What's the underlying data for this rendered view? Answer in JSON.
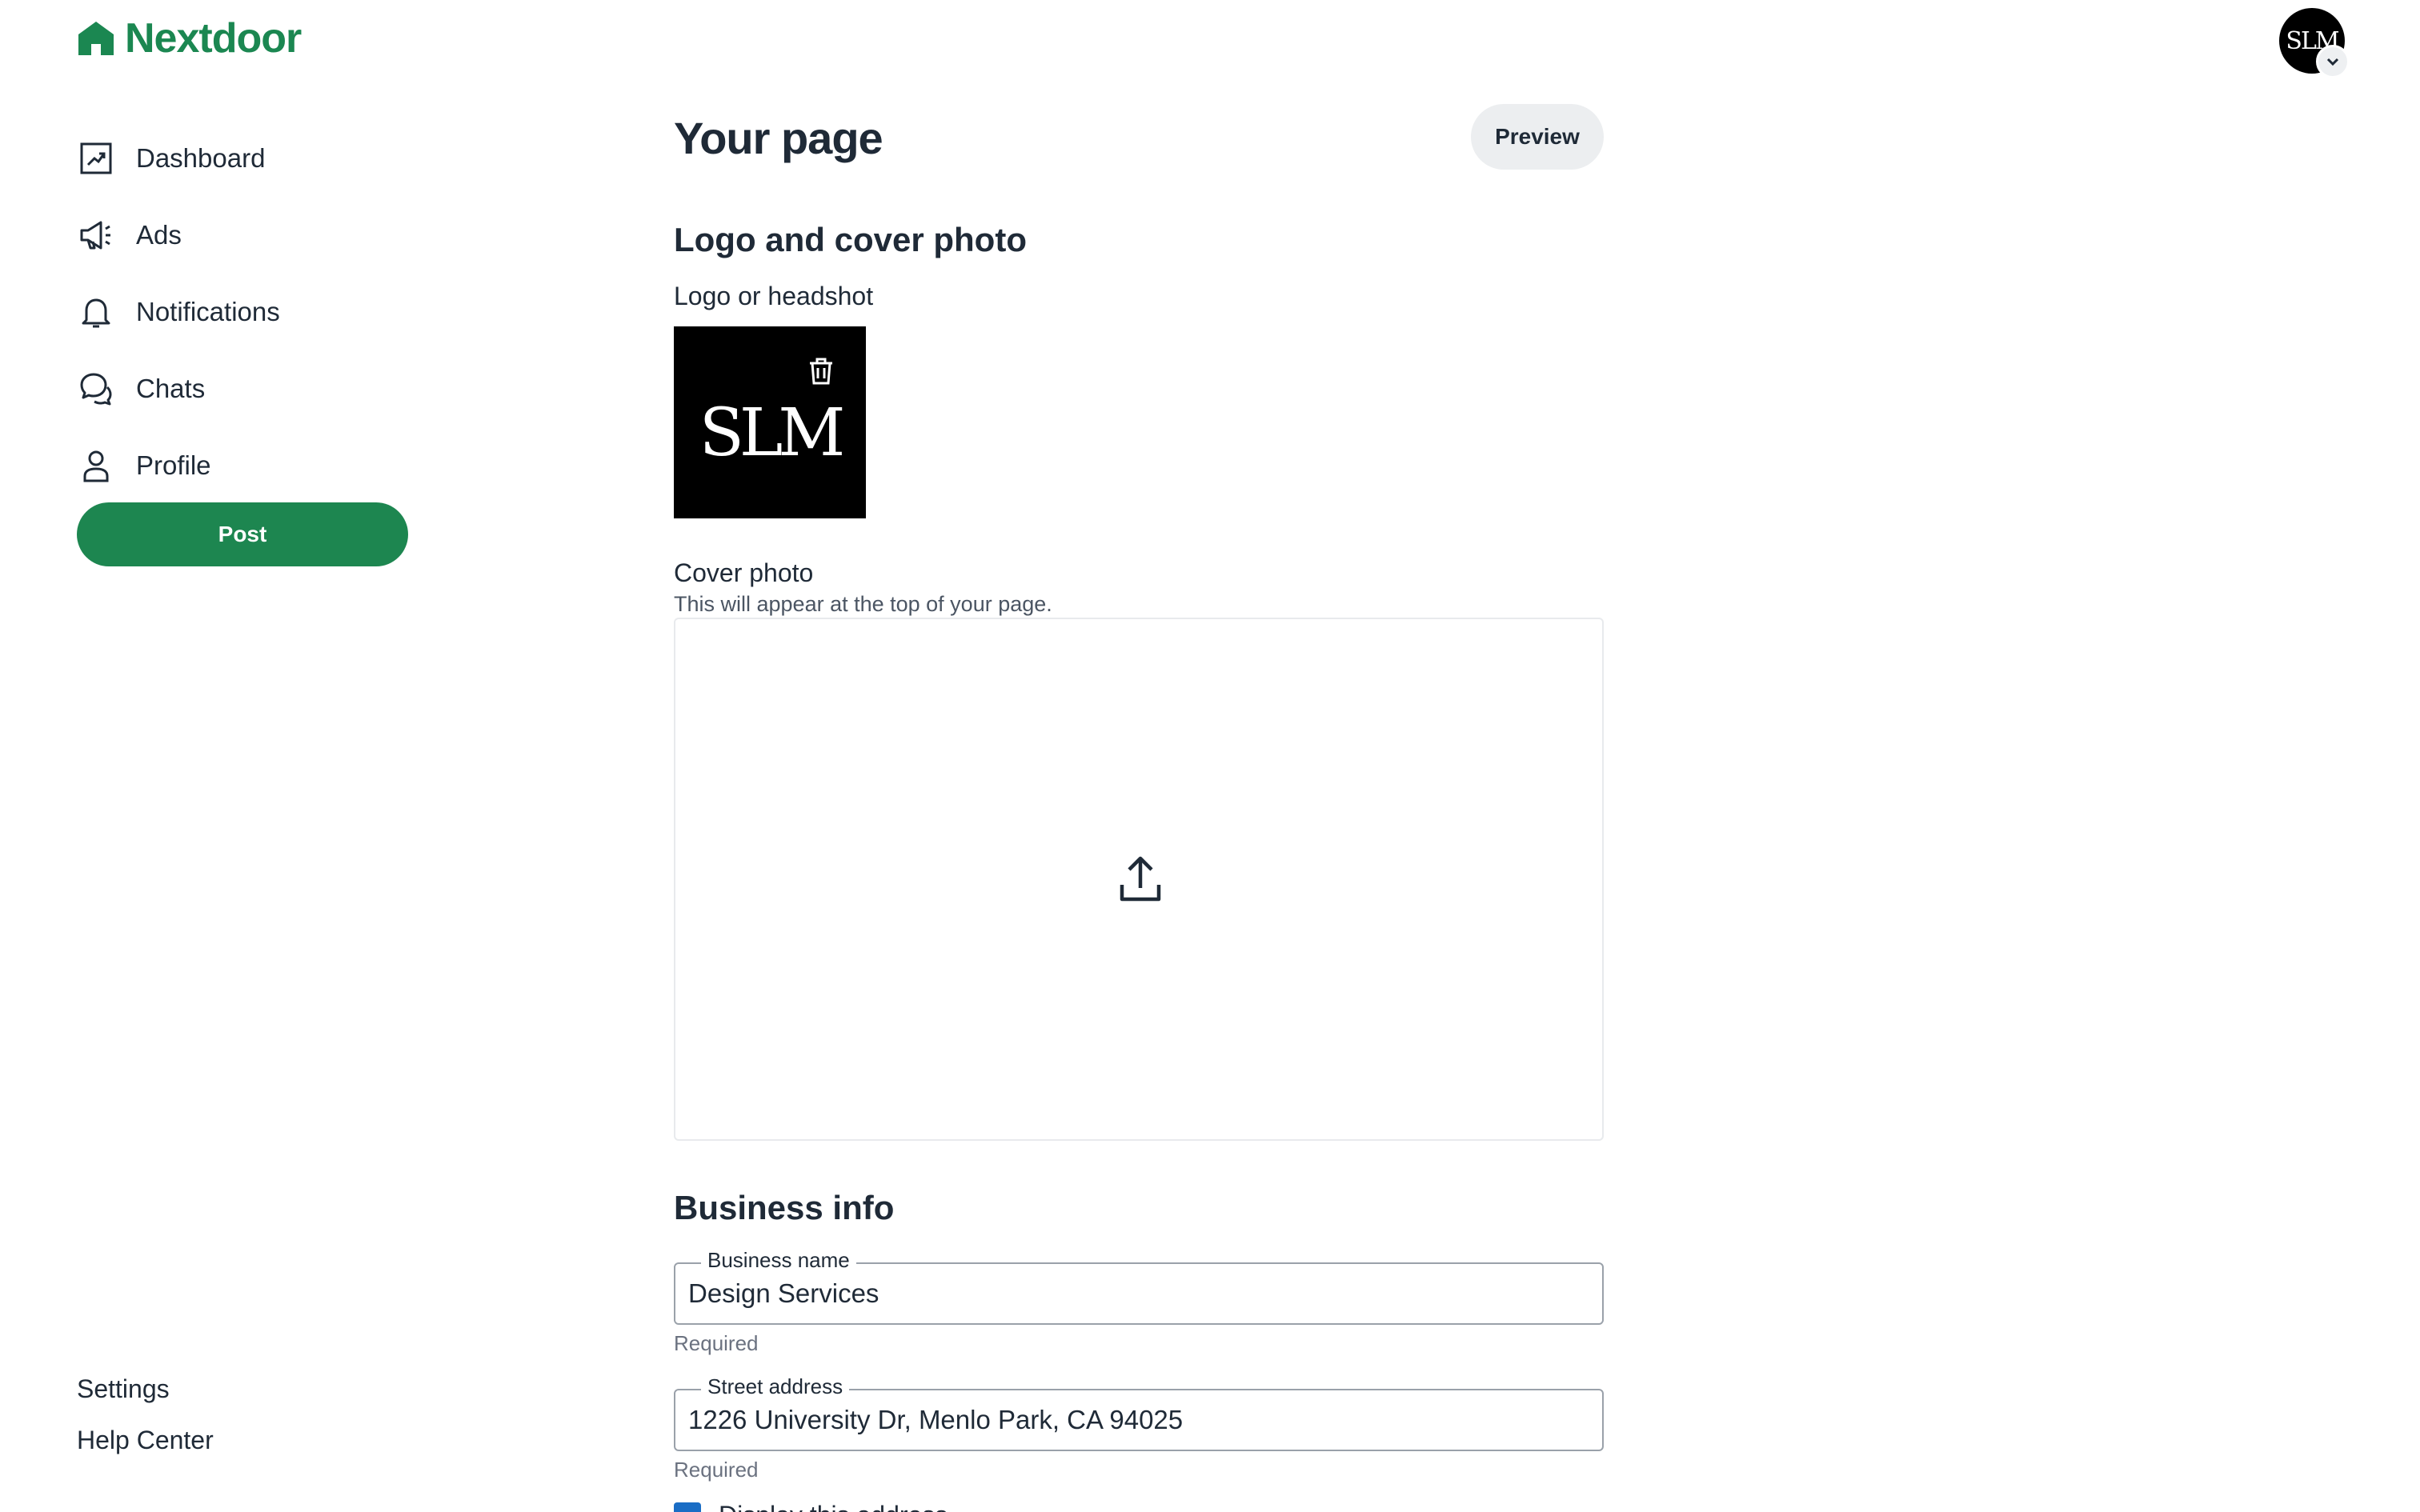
{
  "brand": {
    "name": "Nextdoor",
    "icon": "house-icon",
    "color": "#1b8751"
  },
  "nav": {
    "items": [
      {
        "label": "Dashboard",
        "icon": "dashboard-chart-icon"
      },
      {
        "label": "Ads",
        "icon": "megaphone-icon"
      },
      {
        "label": "Notifications",
        "icon": "bell-icon"
      },
      {
        "label": "Chats",
        "icon": "chat-bubbles-icon"
      },
      {
        "label": "Profile",
        "icon": "person-icon"
      }
    ],
    "post_label": "Post"
  },
  "footer": {
    "settings_label": "Settings",
    "help_label": "Help Center"
  },
  "account": {
    "avatar_text": "SLM",
    "menu_icon": "chevron-down-icon"
  },
  "page": {
    "title": "Your page",
    "preview_label": "Preview"
  },
  "logo_section": {
    "title": "Logo and cover photo",
    "logo_label": "Logo or headshot",
    "logo_text": "SLM",
    "delete_icon": "trash-icon",
    "cover_label": "Cover photo",
    "cover_hint": "This will appear at the top of your page.",
    "upload_icon": "upload-icon"
  },
  "business_info": {
    "title": "Business info",
    "name_field": {
      "label": "Business name",
      "value": "Design Services",
      "helper": "Required"
    },
    "address_field": {
      "label": "Street address",
      "value": "1226 University Dr, Menlo Park, CA 94025",
      "helper": "Required"
    },
    "display_address_label": "Display this address"
  },
  "colors": {
    "accent": "#1d8650",
    "checkbox": "#1a6dc5"
  }
}
